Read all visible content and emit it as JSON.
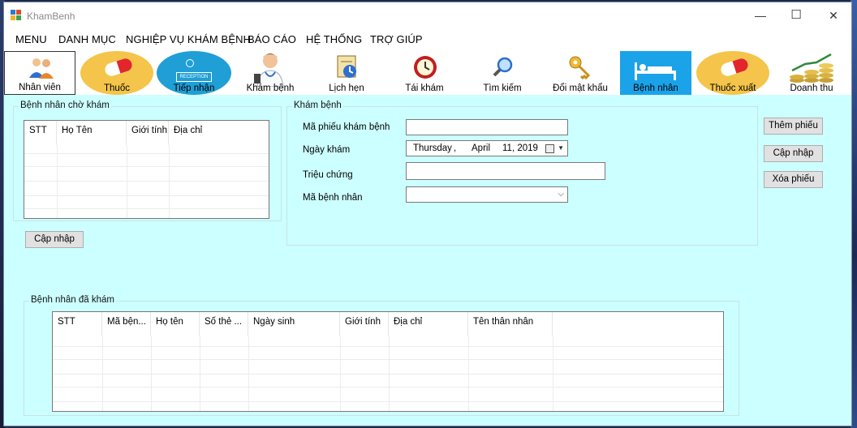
{
  "window": {
    "title": "KhamBenh",
    "controls": {
      "minimize": "—",
      "maximize": "☐",
      "close": "✕"
    }
  },
  "menu": [
    "MENU",
    "DANH MỤC",
    "NGHIỆP VỤ KHÁM BỆNH",
    "BÁO CÁO",
    "HỆ THỐNG",
    "TRỢ GIÚP"
  ],
  "toolbar": {
    "items": [
      {
        "label": "Nhân viên",
        "icon": "staff-icon"
      },
      {
        "label": "Thuốc",
        "icon": "pill-icon"
      },
      {
        "label": "Tiếp nhận",
        "icon": "reception-icon"
      },
      {
        "label": "Khám bệnh",
        "icon": "doctor-icon"
      },
      {
        "label": "Lịch hẹn",
        "icon": "calendar-icon"
      },
      {
        "label": "Tái khám",
        "icon": "clock-icon"
      },
      {
        "label": "Tìm kiếm",
        "icon": "magnifier-icon"
      },
      {
        "label": "Đổi mật khẩu",
        "icon": "key-icon"
      },
      {
        "label": "Bệnh nhân",
        "icon": "patient-bed-icon"
      },
      {
        "label": "Thuốc xuất",
        "icon": "pill-icon"
      },
      {
        "label": "Doanh thu",
        "icon": "coins-chart-icon"
      }
    ],
    "reception_sign": "RECEPTION"
  },
  "waiting": {
    "title": "Bệnh nhân chờ khám",
    "columns": [
      "STT",
      "Họ Tên",
      "Giới tính",
      "Địa chỉ"
    ],
    "refresh_button": "Cập nhập"
  },
  "exam": {
    "title": "Khám bệnh",
    "fields": {
      "ticket_label": "Mã phiếu khám bệnh",
      "ticket_value": "",
      "date_label": "Ngày khám",
      "date_weekday": "Thursday",
      "date_sep": ",",
      "date_month": "April",
      "date_day_year": "11, 2019",
      "symptoms_label": "Triệu chứng",
      "symptoms_value": "",
      "patient_label": "Mã bệnh nhân",
      "patient_value": ""
    },
    "buttons": {
      "add": "Thêm phiếu",
      "update": "Cập nhập",
      "delete": "Xóa phiếu"
    }
  },
  "examined": {
    "title": "Bệnh nhân đã khám",
    "columns": [
      "STT",
      "Mã bện...",
      "Họ tên",
      "Số thẻ ...",
      "Ngày sinh",
      "Giới tính",
      "Địa chỉ",
      "Tên thân nhân"
    ]
  },
  "colors": {
    "form_bg": "#ccffff",
    "selected_tool_bg": "#1aa3e8",
    "pill_yellow": "#f4c54a",
    "pill_red": "#e3262b"
  }
}
